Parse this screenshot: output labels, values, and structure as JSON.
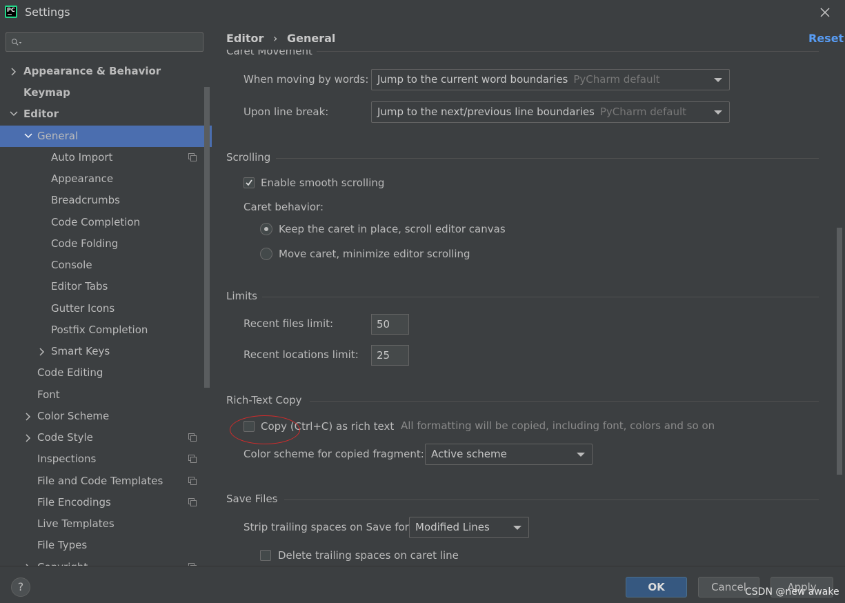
{
  "window": {
    "title": "Settings",
    "app_icon_text": "PC"
  },
  "search": {
    "placeholder": ""
  },
  "sidebar": {
    "items": [
      {
        "label": "Appearance & Behavior"
      },
      {
        "label": "Keymap"
      },
      {
        "label": "Editor"
      },
      {
        "label": "General"
      },
      {
        "label": "Auto Import"
      },
      {
        "label": "Appearance"
      },
      {
        "label": "Breadcrumbs"
      },
      {
        "label": "Code Completion"
      },
      {
        "label": "Code Folding"
      },
      {
        "label": "Console"
      },
      {
        "label": "Editor Tabs"
      },
      {
        "label": "Gutter Icons"
      },
      {
        "label": "Postfix Completion"
      },
      {
        "label": "Smart Keys"
      },
      {
        "label": "Code Editing"
      },
      {
        "label": "Font"
      },
      {
        "label": "Color Scheme"
      },
      {
        "label": "Code Style"
      },
      {
        "label": "Inspections"
      },
      {
        "label": "File and Code Templates"
      },
      {
        "label": "File Encodings"
      },
      {
        "label": "Live Templates"
      },
      {
        "label": "File Types"
      },
      {
        "label": "Copyright"
      }
    ]
  },
  "content": {
    "breadcrumb": {
      "parent": "Editor",
      "separator": "›",
      "current": "General"
    },
    "reset_label": "Reset",
    "caret_movement": {
      "title": "Caret Movement",
      "moving_by_words": {
        "label": "When moving by words:",
        "value": "Jump to the current word boundaries",
        "hint": "PyCharm default"
      },
      "line_break": {
        "label": "Upon line break:",
        "value": "Jump to the next/previous line boundaries",
        "hint": "PyCharm default"
      }
    },
    "scrolling": {
      "title": "Scrolling",
      "smooth_scrolling": {
        "label": "Enable smooth scrolling",
        "checked": true
      },
      "caret_behavior_label": "Caret behavior:",
      "options": [
        {
          "label": "Keep the caret in place, scroll editor canvas",
          "selected": true
        },
        {
          "label": "Move caret, minimize editor scrolling",
          "selected": false
        }
      ]
    },
    "limits": {
      "title": "Limits",
      "recent_files": {
        "label": "Recent files limit:",
        "value": "50"
      },
      "recent_locations": {
        "label": "Recent locations limit:",
        "value": "25"
      }
    },
    "rich_text": {
      "title": "Rich-Text Copy",
      "copy_rich": {
        "label": "Copy (Ctrl+C) as rich text",
        "checked": false,
        "hint": "All formatting will be copied, including font, colors and so on"
      },
      "color_scheme": {
        "label": "Color scheme for copied fragment:",
        "value": "Active scheme"
      }
    },
    "save_files": {
      "title": "Save Files",
      "strip_trailing": {
        "label": "Strip trailing spaces on Save for:",
        "value": "Modified Lines"
      },
      "delete_trailing": {
        "label": "Delete trailing spaces on caret line",
        "checked": false
      }
    }
  },
  "footer": {
    "help_label": "?",
    "ok_label": "OK",
    "cancel_label": "Cancel",
    "apply_label": "Apply",
    "watermark": "CSDN @new awake"
  },
  "colors": {
    "background": "#3c3f41",
    "selection": "#4b6eaf",
    "link": "#589df6",
    "ok_button": "#365880",
    "annotation": "#d22b2b"
  }
}
